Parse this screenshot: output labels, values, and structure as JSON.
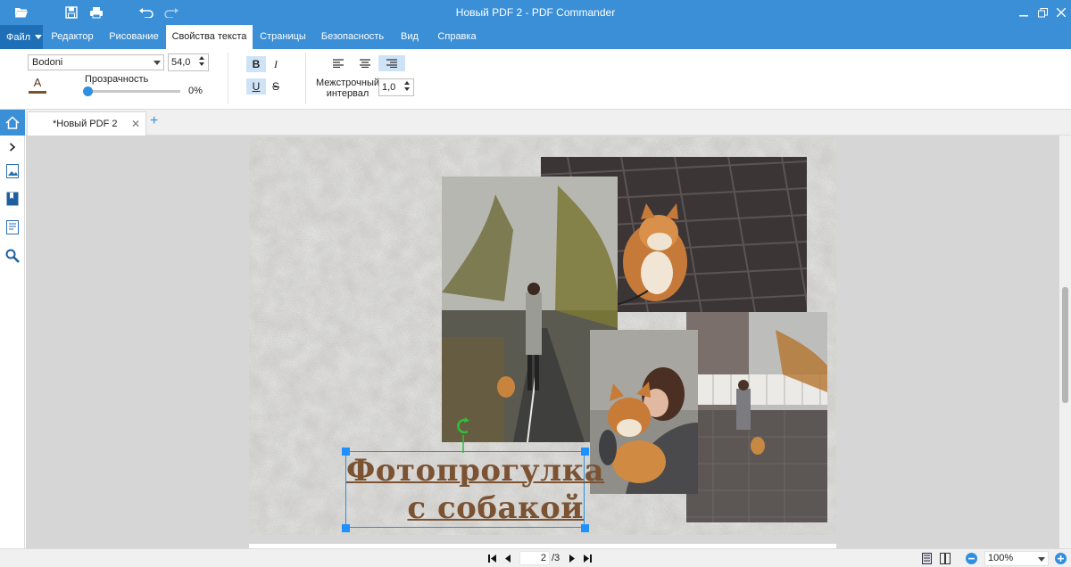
{
  "window": {
    "title": "Новый PDF 2 - PDF Commander"
  },
  "menu": {
    "file_label": "Файл",
    "tabs": [
      "Редактор",
      "Рисование",
      "Свойства текста",
      "Страницы",
      "Безопасность",
      "Вид",
      "Справка"
    ],
    "active_tab": "Свойства текста"
  },
  "ribbon": {
    "font_name": "Bodoni",
    "font_size": "54,0",
    "text_color_glyph": "A",
    "text_color": "#7a5230",
    "opacity_label": "Прозрачность",
    "opacity_value": "0%",
    "opacity_fraction": 0,
    "bold_glyph": "B",
    "italic_glyph": "I",
    "underline_glyph": "U",
    "strike_glyph": "S",
    "bold_active": true,
    "underline_active": true,
    "align_active": "right",
    "line_spacing_label_1": "Межстрочный",
    "line_spacing_label_2": "интервал",
    "line_spacing_value": "1,0"
  },
  "document_tab": {
    "label": "*Новый PDF 2",
    "close": "✕",
    "add": "+"
  },
  "page_content": {
    "heading_line1": "Фотопрогулка",
    "heading_line2": "с собакой",
    "heading_color": "#7b5333"
  },
  "statusbar": {
    "current_page": "2",
    "total_pages": "/3",
    "zoom": "100%"
  },
  "colors": {
    "accent": "#3a8fd6",
    "selection": "#1e90ff"
  }
}
